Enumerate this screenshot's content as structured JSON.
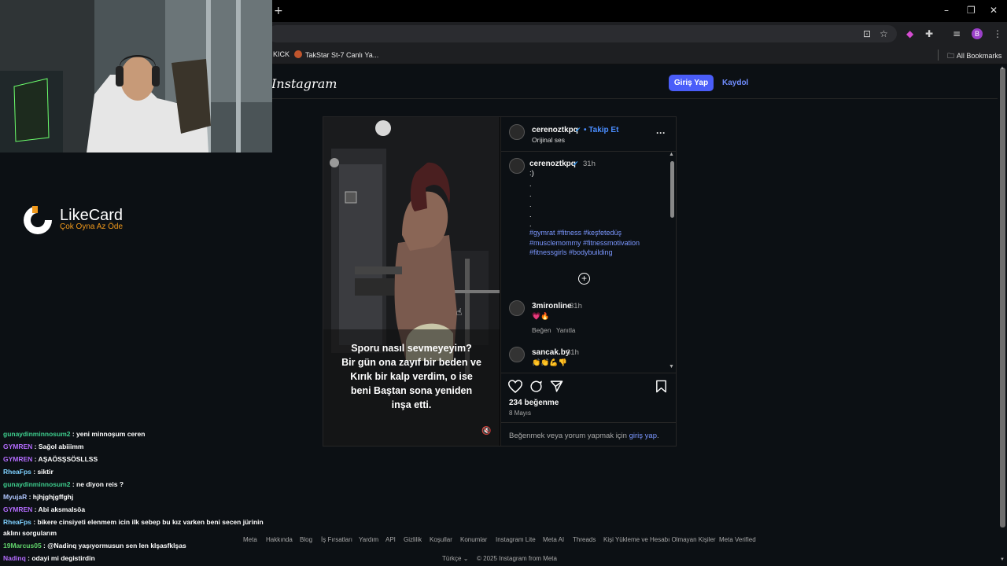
{
  "browser": {
    "new_tab": "+",
    "win_min": "–",
    "win_max": "❐",
    "win_close": "✕",
    "bookmarks": [
      {
        "label": "KICK"
      },
      {
        "label": "TakStar St-7 Canlı Ya..."
      }
    ],
    "all_bookmarks": "All Bookmarks",
    "profile_letter": "B"
  },
  "instagram": {
    "logo": "Instagram",
    "login_button": "Giriş Yap",
    "signup_link": "Kaydol",
    "post": {
      "author": "cerenoztkpq",
      "follow": "• Takip Et",
      "audio": "Orijinal ses",
      "caption_user": "cerenoztkpq",
      "caption_time": "31h",
      "caption_text": ":)",
      "caption_dots": [
        ".",
        ".",
        ".",
        ".",
        "."
      ],
      "hashtags_line1": "#gymrat #fitness #keşfetedüş",
      "hashtags_line2": "#musclemommy #fitnessmotivation",
      "hashtags_line3": "#fitnessgirls #bodybuilding",
      "comments": [
        {
          "user": "3mironline",
          "time": "31h",
          "text": "💗🔥",
          "like": "Beğen",
          "reply": "Yanıtla"
        },
        {
          "user": "sancak.by",
          "time": "31h",
          "text": "👏👏💪👎"
        }
      ],
      "likes": "234 beğenme",
      "date": "8 Mayıs",
      "cta_text": "Beğenmek veya yorum yapmak için",
      "cta_link": "giriş yap",
      "cta_end": ".",
      "overlay_text": [
        "Sporu nasıl sevmeyeyim?",
        "Bir gün ona zayıf bir beden ve",
        "Kırık bir kalp verdim, o ise",
        "beni Baştan sona yeniden",
        "inşa etti."
      ]
    },
    "footer_links": [
      "Meta",
      "Hakkında",
      "Blog",
      "İş Fırsatları",
      "Yardım",
      "API",
      "Gizlilik",
      "Koşullar",
      "Konumlar",
      "Instagram Lite",
      "Meta AI",
      "Threads",
      "Kişi Yükleme ve Hesabı Olmayan Kişiler",
      "Meta Verified"
    ],
    "language": "Türkçe",
    "copyright": "© 2025 Instagram from Meta"
  },
  "stream": {
    "brand_name": "LikeCard",
    "brand_tagline": "Çok Oyna  Az Öde",
    "chat": [
      {
        "user": "gunaydinminnosum2",
        "msg": " : yeni minnoşum ceren",
        "color": "#3ecf8e"
      },
      {
        "user": "GYMREN",
        "msg": " : Sağol abiiimm",
        "color": "#b46cff"
      },
      {
        "user": "GYMREN",
        "msg": " : AŞAÖSŞSÖSLLSS",
        "color": "#b46cff"
      },
      {
        "user": "RheaFps",
        "msg": " : siktir",
        "color": "#7fd1ff"
      },
      {
        "user": "gunaydinminnosum2",
        "msg": " : ne diyon reis ?",
        "color": "#3ecf8e"
      },
      {
        "user": "MyujaR",
        "msg": " : hjhjghjgffghj",
        "color": "#b0c7ff"
      },
      {
        "user": "GYMREN",
        "msg": " : Abi aksmalsöa",
        "color": "#b46cff"
      },
      {
        "user": "RheaFps",
        "msg": " : bikere cinsiyeti elenmem icin ilk sebep bu kız varken beni secen jürinin",
        "color": "#7fd1ff"
      },
      {
        "user": "",
        "msg": "aklını sorgularım",
        "color": "#ffffff"
      },
      {
        "user": "19Marcus05",
        "msg": " : @Nadinq yaşıyormusun sen len klşasfklşas",
        "color": "#61d36b"
      },
      {
        "user": "Nadinq",
        "msg": " : odayi mi degistirdin",
        "color": "#b46cff"
      }
    ]
  }
}
